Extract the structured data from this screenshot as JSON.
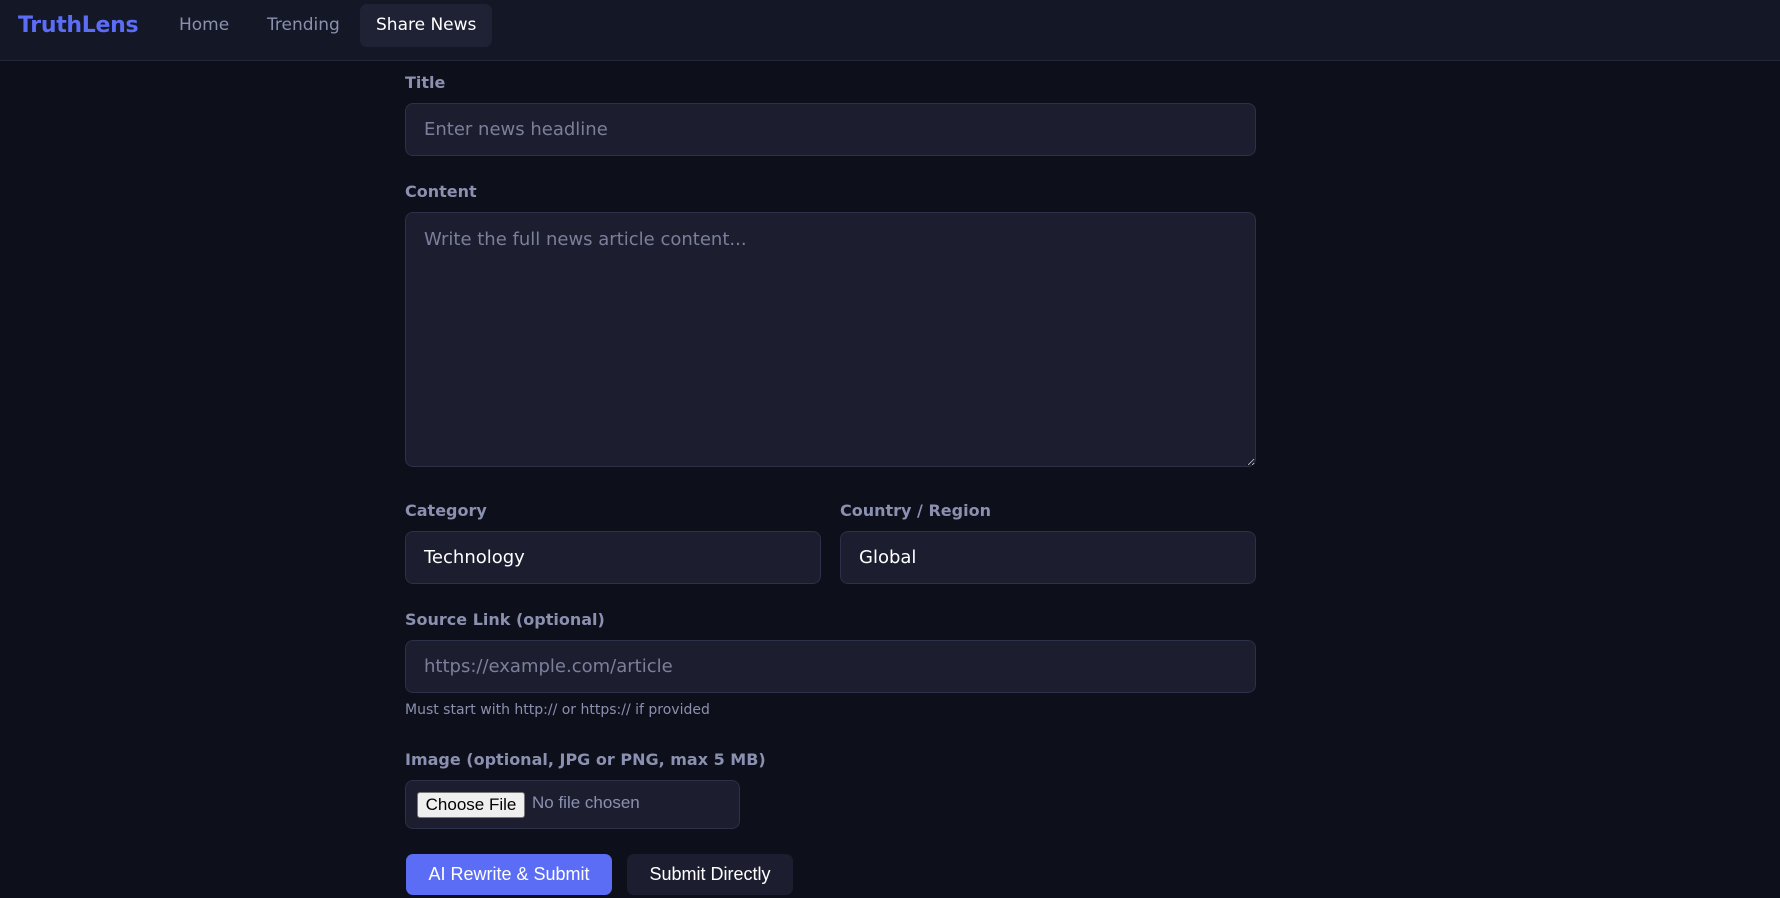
{
  "nav": {
    "brand": "TruthLens",
    "links": [
      {
        "label": "Home"
      },
      {
        "label": "Trending"
      },
      {
        "label": "Share News"
      }
    ]
  },
  "form": {
    "title": {
      "label": "Title",
      "placeholder": "Enter news headline"
    },
    "content": {
      "label": "Content",
      "placeholder": "Write the full news article content..."
    },
    "category": {
      "label": "Category",
      "value": "Technology"
    },
    "country": {
      "label": "Country / Region",
      "value": "Global"
    },
    "source": {
      "label": "Source Link (optional)",
      "placeholder": "https://example.com/article",
      "hint": "Must start with http:// or https:// if provided"
    },
    "image": {
      "label": "Image (optional, JPG or PNG, max 5 MB)",
      "button": "Choose File",
      "status": "No file chosen"
    },
    "buttons": {
      "ai_submit": "AI Rewrite & Submit",
      "direct_submit": "Submit Directly"
    }
  },
  "colors": {
    "background": "#0d0f1a",
    "accent": "#5b6cf5",
    "field": "#1c1e30"
  }
}
